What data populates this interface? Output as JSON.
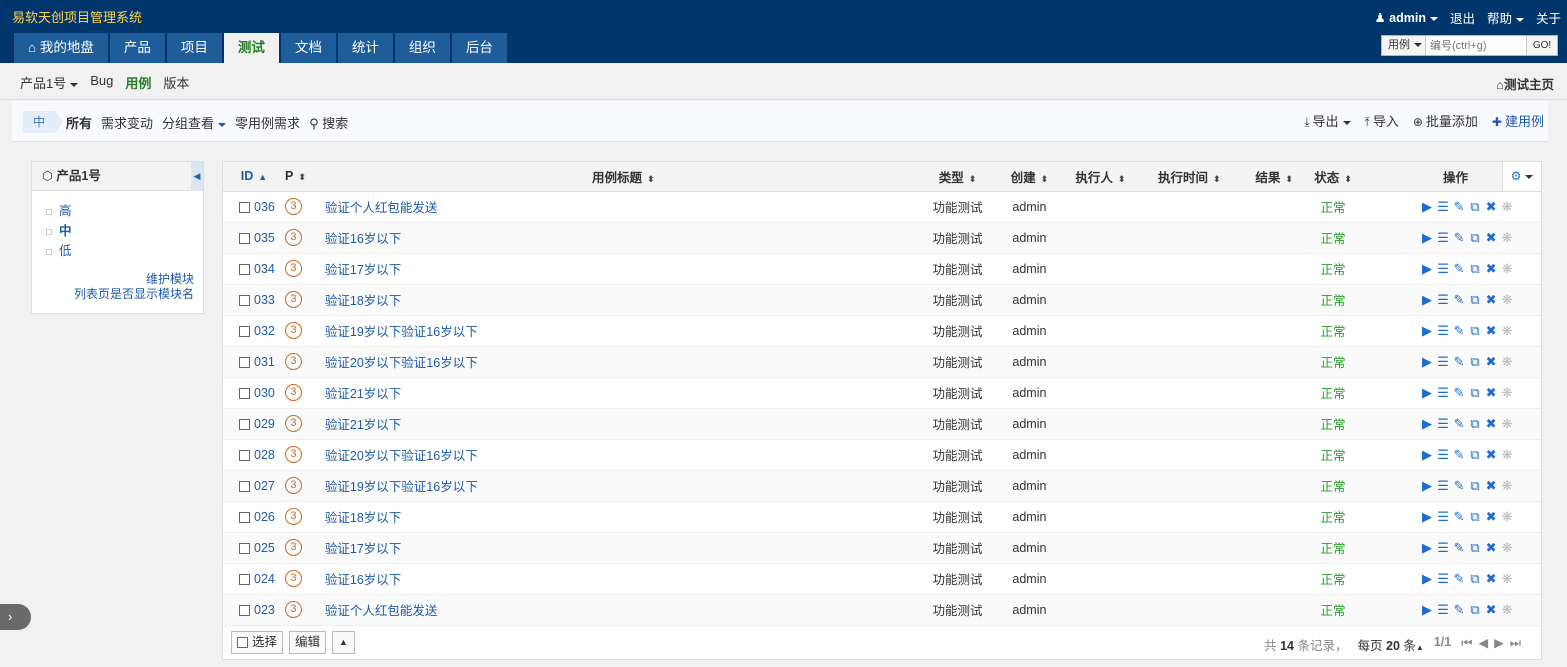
{
  "header": {
    "title": "易软天创项目管理系统",
    "user": "admin",
    "logout": "退出",
    "help": "帮助",
    "about": "关于"
  },
  "mainnav": {
    "tabs": [
      {
        "label": "我的地盘",
        "icon": "home-icon",
        "active": false
      },
      {
        "label": "产品",
        "active": false
      },
      {
        "label": "项目",
        "active": false
      },
      {
        "label": "测试",
        "active": true
      },
      {
        "label": "文档",
        "active": false
      },
      {
        "label": "统计",
        "active": false
      },
      {
        "label": "组织",
        "active": false
      },
      {
        "label": "后台",
        "active": false
      }
    ]
  },
  "search": {
    "type": "用例",
    "placeholder": "编号(ctrl+g)",
    "go": "GO!"
  },
  "subnav": {
    "product": "产品1号",
    "items": [
      "Bug",
      "用例",
      "版本"
    ],
    "active": "用例",
    "home": "测试主页"
  },
  "featurebar": {
    "flag": "中",
    "filters": [
      "所有",
      "需求变动",
      "分组查看",
      "零用例需求",
      "搜索"
    ],
    "actions": [
      "导出",
      "导入",
      "批量添加",
      "建用例"
    ]
  },
  "sidebar": {
    "title": "产品1号",
    "items": [
      {
        "label": "高",
        "active": false
      },
      {
        "label": "中",
        "active": true
      },
      {
        "label": "低",
        "active": false
      }
    ],
    "link1": "维护模块",
    "link2": "列表页是否显示模块名"
  },
  "table": {
    "columns": {
      "id": "ID",
      "pri": "P",
      "title": "用例标题",
      "type": "类型",
      "creator": "创建",
      "executor": "执行人",
      "exectime": "执行时间",
      "result": "结果",
      "status": "状态",
      "ops": "操作"
    },
    "rows": [
      {
        "id": "036",
        "pri": "3",
        "title": "验证个人红包能发送",
        "type": "功能测试",
        "creator": "admin",
        "status": "正常"
      },
      {
        "id": "035",
        "pri": "3",
        "title": "验证16岁以下",
        "type": "功能测试",
        "creator": "admin",
        "status": "正常"
      },
      {
        "id": "034",
        "pri": "3",
        "title": "验证17岁以下",
        "type": "功能测试",
        "creator": "admin",
        "status": "正常"
      },
      {
        "id": "033",
        "pri": "3",
        "title": "验证18岁以下",
        "type": "功能测试",
        "creator": "admin",
        "status": "正常"
      },
      {
        "id": "032",
        "pri": "3",
        "title": "验证19岁以下验证16岁以下",
        "type": "功能测试",
        "creator": "admin",
        "status": "正常"
      },
      {
        "id": "031",
        "pri": "3",
        "title": "验证20岁以下验证16岁以下",
        "type": "功能测试",
        "creator": "admin",
        "status": "正常"
      },
      {
        "id": "030",
        "pri": "3",
        "title": "验证21岁以下",
        "type": "功能测试",
        "creator": "admin",
        "status": "正常"
      },
      {
        "id": "029",
        "pri": "3",
        "title": "验证21岁以下",
        "type": "功能测试",
        "creator": "admin",
        "status": "正常"
      },
      {
        "id": "028",
        "pri": "3",
        "title": "验证20岁以下验证16岁以下",
        "type": "功能测试",
        "creator": "admin",
        "status": "正常"
      },
      {
        "id": "027",
        "pri": "3",
        "title": "验证19岁以下验证16岁以下",
        "type": "功能测试",
        "creator": "admin",
        "status": "正常"
      },
      {
        "id": "026",
        "pri": "3",
        "title": "验证18岁以下",
        "type": "功能测试",
        "creator": "admin",
        "status": "正常"
      },
      {
        "id": "025",
        "pri": "3",
        "title": "验证17岁以下",
        "type": "功能测试",
        "creator": "admin",
        "status": "正常"
      },
      {
        "id": "024",
        "pri": "3",
        "title": "验证16岁以下",
        "type": "功能测试",
        "creator": "admin",
        "status": "正常"
      },
      {
        "id": "023",
        "pri": "3",
        "title": "验证个人红包能发送",
        "type": "功能测试",
        "creator": "admin",
        "status": "正常"
      }
    ]
  },
  "footer": {
    "select": "选择",
    "edit": "编辑",
    "total_prefix": "共",
    "total": "14",
    "total_suffix": "条记录，",
    "perpage_prefix": "每页",
    "perpage": "20",
    "perpage_suffix": "条",
    "page": "1/1"
  },
  "colors": {
    "header_bg": "#00366b",
    "tab_bg": "#1f5c9a",
    "title_yellow": "#ffd34f",
    "link_blue": "#1e5aa7",
    "status_green": "#2a9d2a",
    "priority_orange": "#c86a2a"
  }
}
